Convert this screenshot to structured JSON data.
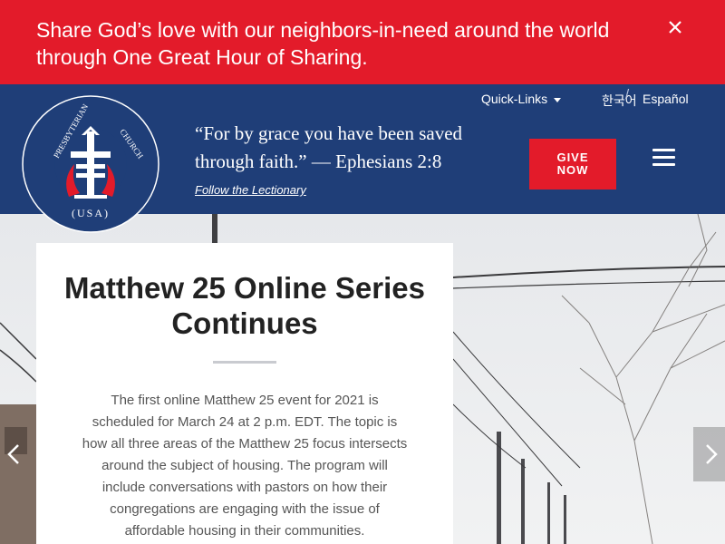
{
  "alert": {
    "text": "Share God’s love with our neighbors-in-need around the world through One Great Hour of Sharing.",
    "close_icon": "close-icon"
  },
  "utility": {
    "quick_links": "Quick-Links",
    "lang_korean": "한국어",
    "separator": "/",
    "lang_spanish": "Español"
  },
  "header": {
    "logo_alt": "PRESBYTERIAN CHURCH (USA)",
    "quote": "“For by grace you have been saved through faith.” — Ephesians 2:8",
    "lectionary_link": "Follow the Lectionary",
    "give_label": "GIVE NOW",
    "menu_icon": "hamburger-menu-icon"
  },
  "hero": {
    "title": "Matthew 25 Online Series Continues",
    "body": "The first online Matthew 25 event for 2021 is scheduled for March 24 at 2 p.m. EDT. The topic is how all three areas of the Matthew 25 focus intersects around the subject of housing. The program will include conversations with pastors on how their congregations are engaging with the issue of affordable housing in their communities.",
    "prev_icon": "chevron-left-icon",
    "next_icon": "chevron-right-icon"
  },
  "colors": {
    "brand_red": "#e31b2a",
    "brand_blue": "#1f3e78"
  }
}
